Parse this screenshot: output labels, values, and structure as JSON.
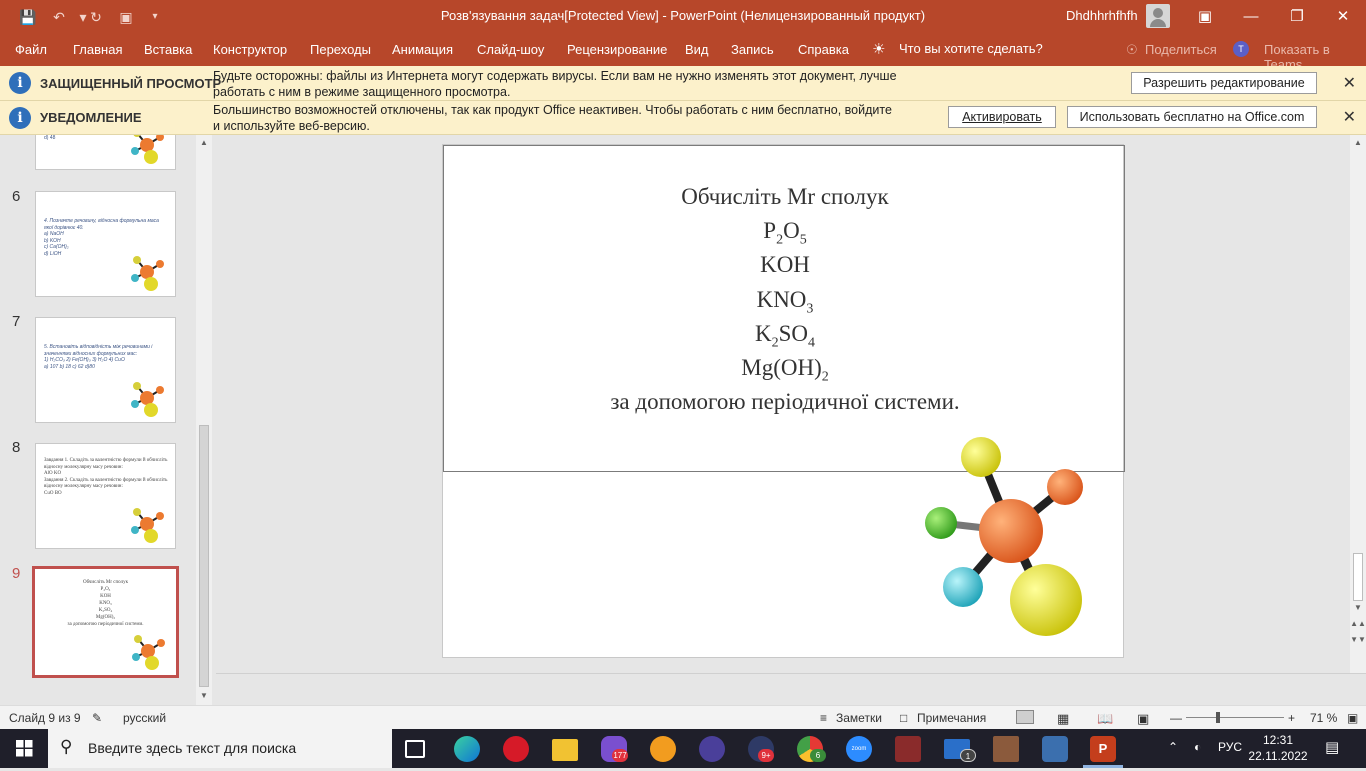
{
  "window": {
    "title": "Розв'язування задач[Protected View]  -  PowerPoint (Нелицензированный продукт)",
    "user_name": "Dhdhhrhfhfh"
  },
  "ribbon": {
    "tabs": [
      "Файл",
      "Главная",
      "Вставка",
      "Конструктор",
      "Переходы",
      "Анимация",
      "Слайд-шоу",
      "Рецензирование",
      "Вид",
      "Запись",
      "Справка"
    ],
    "tell_me": "Что вы хотите сделать?",
    "share": "Поделиться",
    "teams": "Показать в Teams"
  },
  "protected_bar": {
    "heading": "ЗАЩИЩЕННЫЙ ПРОСМОТР",
    "message": "Будьте осторожны: файлы из Интернета могут содержать вирусы. Если вам не нужно изменять этот документ, лучше работать с ним в режиме защищенного просмотра.",
    "button": "Разрешить редактирование"
  },
  "notice_bar": {
    "heading": "УВЕДОМЛЕНИЕ",
    "message": "Большинство возможностей отключены, так как продукт Office неактивен. Чтобы работать с ним бесплатно, войдите и используйте веб-версию.",
    "activate_button": "Активировать",
    "free_button": "Использовать бесплатно на Office.com"
  },
  "thumbnails": {
    "partial_text": "d)  48",
    "items": [
      {
        "number": "6",
        "text": "4. Позначте речовину, відносна формульна маса якої дорівнює 40.\na)  NaOH\nb)  KOH\nc)  Ca(OH)₂\nd)  LiOH"
      },
      {
        "number": "7",
        "text": "5. Встановіть відповідність між речовинами і значеннями відносних формульних мас:\n1) H₂CO₃    2) Fe(OH)₃    3) H₂O    4) CuO\na) 107       b) 18        c) 62       d)80"
      },
      {
        "number": "8",
        "text": "Завдання 1. Складіть за валентністю формули й обчисліть відносну молекулярну масу речовин:\nAlO  KO\nЗавдання 2. Складіть за валентністю формули й обчисліть відносну молекулярну масу речовин:\nCuO  BO"
      },
      {
        "number": "9",
        "text": "Обчисліть Mr сполук\nP₂O₅\nKOH\nKNO₃\nK₂SO₄\nMg(OH)₂\nза допомогою періодичної системи."
      }
    ]
  },
  "slide": {
    "line1": "Обчисліть Mr сполук",
    "f1a": "P",
    "f1b": "2",
    "f1c": "O",
    "f1d": "5",
    "f2": "KOH",
    "f3a": "KNO",
    "f3b": "3",
    "f4a": "K",
    "f4b": "2",
    "f4c": "SO",
    "f4d": "4",
    "f5a": "Mg(OH)",
    "f5b": "2",
    "line_last": "за допомогою періодичної системи."
  },
  "status": {
    "slide_counter": "Слайд 9 из 9",
    "language": "русский",
    "notes": "Заметки",
    "comments": "Примечания",
    "zoom": "71 %"
  },
  "taskbar": {
    "search_placeholder": "Введите здесь текст для поиска",
    "viber_badge": "177",
    "steam_badge": "9+",
    "chrome_badge": "6",
    "mail_badge": "1",
    "lang": "РУС",
    "time": "12:31",
    "date": "22.11.2022"
  },
  "colors": {
    "accent": "#b7472a",
    "selected_slide": "#c0504d",
    "message_bar": "#fcf1cb"
  }
}
